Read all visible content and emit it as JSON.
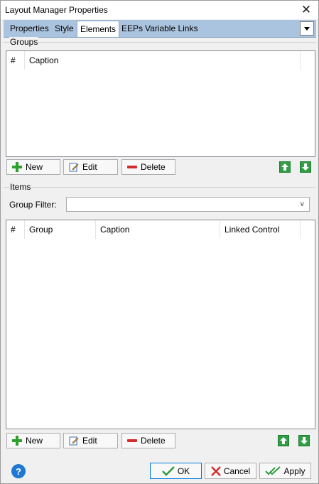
{
  "window": {
    "title": "Layout Manager Properties",
    "close_glyph": "✕"
  },
  "tabs": [
    {
      "label": "Properties",
      "active": false
    },
    {
      "label": "Style",
      "active": false
    },
    {
      "label": "Elements",
      "active": true
    },
    {
      "label": "EEPs",
      "active": false
    },
    {
      "label": "Variable Links",
      "active": false
    }
  ],
  "groups": {
    "label": "Groups",
    "columns": [
      "#",
      "Caption"
    ],
    "rows": [],
    "buttons": {
      "new": "New",
      "edit": "Edit",
      "delete": "Delete"
    }
  },
  "items": {
    "label": "Items",
    "filter_label": "Group Filter:",
    "filter_value": "",
    "columns": [
      "#",
      "Group",
      "Caption",
      "Linked Control"
    ],
    "rows": [],
    "buttons": {
      "new": "New",
      "edit": "Edit",
      "delete": "Delete"
    }
  },
  "footer": {
    "help_glyph": "?",
    "ok": "OK",
    "cancel": "Cancel",
    "apply": "Apply"
  },
  "colors": {
    "tab_strip": "#aac3de",
    "accent_green": "#2f9e44",
    "delete_red": "#d12b2b",
    "help_blue": "#1f78d1",
    "default_button_border": "#0078d7"
  },
  "icons": {
    "new": "plus-icon",
    "edit": "pencil-icon",
    "delete": "minus-icon",
    "up": "arrow-up-icon",
    "down": "arrow-down-icon",
    "ok": "checkmark-icon",
    "cancel": "x-icon",
    "apply": "double-check-icon",
    "help": "help-icon"
  }
}
